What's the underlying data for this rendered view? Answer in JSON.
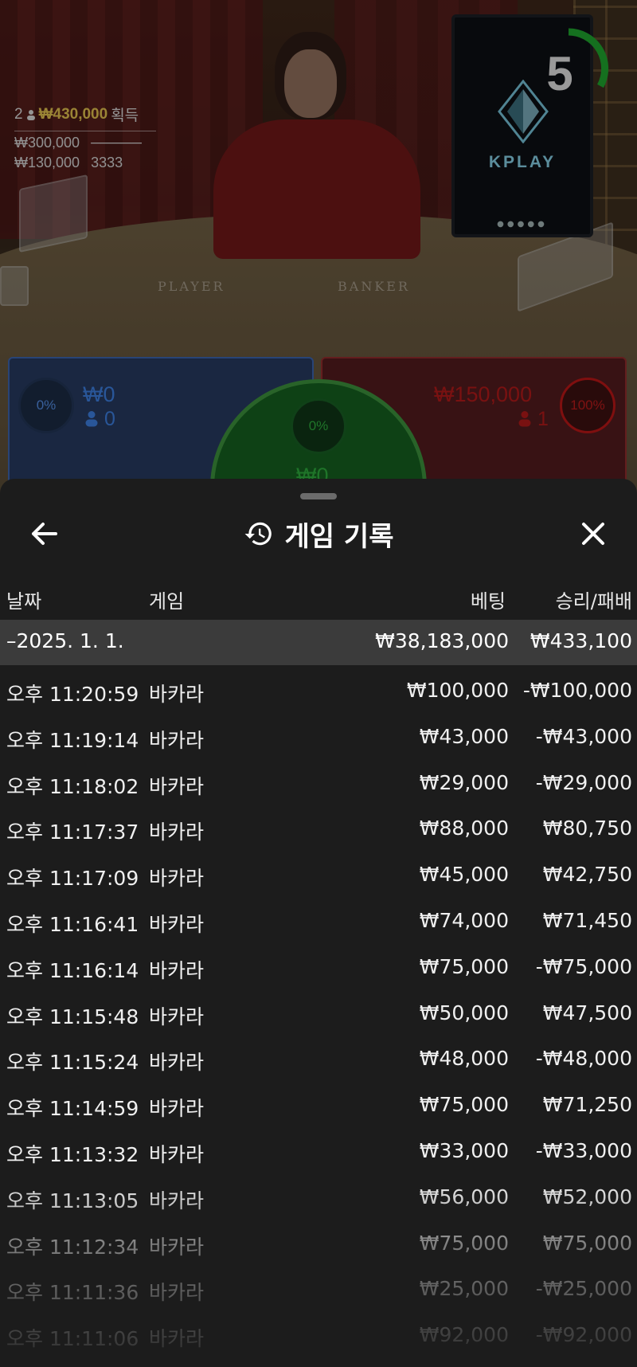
{
  "stream": {
    "timer": "5",
    "monitor_brand": "KPLAY",
    "table_labels": {
      "player": "PLAYER",
      "banker": "BANKER"
    },
    "winners": {
      "count": "2",
      "total": "₩430,000",
      "total_suffix": "획득",
      "entries": [
        {
          "amount": "₩300,000",
          "name": "─────"
        },
        {
          "amount": "₩130,000",
          "name": "3333"
        }
      ]
    },
    "bets": {
      "player": {
        "percent": "0%",
        "amount": "₩0",
        "count": "0"
      },
      "banker": {
        "percent": "100%",
        "amount": "₩150,000",
        "count": "1"
      },
      "tie": {
        "percent": "0%",
        "amount": "₩0"
      }
    }
  },
  "sheet": {
    "title": "게임 기록",
    "columns": {
      "date": "날짜",
      "game": "게임",
      "bet": "베팅",
      "result": "승리/패배"
    },
    "summary": {
      "date": "–2025. 1. 1.",
      "bet": "₩38,183,000",
      "result": "₩433,100"
    },
    "rows": [
      {
        "time": "오후 11:20:59",
        "game": "바카라",
        "bet": "₩100,000",
        "result": "-₩100,000"
      },
      {
        "time": "오후 11:19:14",
        "game": "바카라",
        "bet": "₩43,000",
        "result": "-₩43,000"
      },
      {
        "time": "오후 11:18:02",
        "game": "바카라",
        "bet": "₩29,000",
        "result": "-₩29,000"
      },
      {
        "time": "오후 11:17:37",
        "game": "바카라",
        "bet": "₩88,000",
        "result": "₩80,750"
      },
      {
        "time": "오후 11:17:09",
        "game": "바카라",
        "bet": "₩45,000",
        "result": "₩42,750"
      },
      {
        "time": "오후 11:16:41",
        "game": "바카라",
        "bet": "₩74,000",
        "result": "₩71,450"
      },
      {
        "time": "오후 11:16:14",
        "game": "바카라",
        "bet": "₩75,000",
        "result": "-₩75,000"
      },
      {
        "time": "오후 11:15:48",
        "game": "바카라",
        "bet": "₩50,000",
        "result": "₩47,500"
      },
      {
        "time": "오후 11:15:24",
        "game": "바카라",
        "bet": "₩48,000",
        "result": "-₩48,000"
      },
      {
        "time": "오후 11:14:59",
        "game": "바카라",
        "bet": "₩75,000",
        "result": "₩71,250"
      },
      {
        "time": "오후 11:13:32",
        "game": "바카라",
        "bet": "₩33,000",
        "result": "-₩33,000"
      },
      {
        "time": "오후 11:13:05",
        "game": "바카라",
        "bet": "₩56,000",
        "result": "₩52,000"
      },
      {
        "time": "오후 11:12:34",
        "game": "바카라",
        "bet": "₩75,000",
        "result": "₩75,000"
      },
      {
        "time": "오후 11:11:36",
        "game": "바카라",
        "bet": "₩25,000",
        "result": "-₩25,000"
      },
      {
        "time": "오후 11:11:06",
        "game": "바카라",
        "bet": "₩92,000",
        "result": "-₩92,000"
      }
    ]
  },
  "colors": {
    "player_blue": "#3a78d4",
    "banker_red": "#a81818",
    "tie_green": "#2ca23a",
    "gold": "#d6b84a",
    "sheet_bg": "#1c1c1c",
    "summary_bg": "#3b3b3b"
  }
}
